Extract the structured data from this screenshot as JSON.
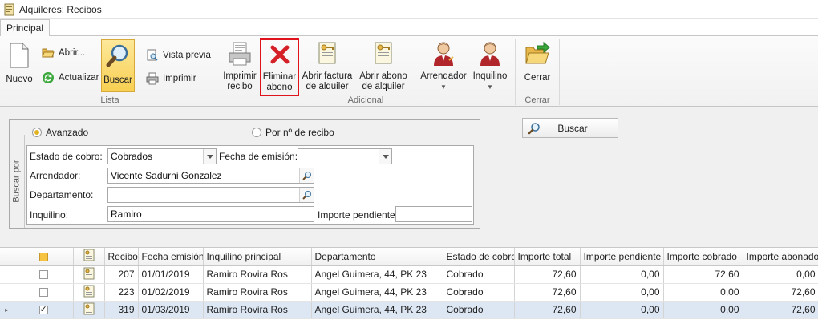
{
  "window": {
    "title": "Alquileres: Recibos"
  },
  "tabs": [
    {
      "label": "Principal"
    }
  ],
  "ribbon": {
    "lista": {
      "label": "Lista",
      "nuevo": "Nuevo",
      "abrir": "Abrir...",
      "actualizar": "Actualizar",
      "buscar": "Buscar",
      "vista_previa": "Vista previa",
      "imprimir": "Imprimir"
    },
    "adicional": {
      "label": "Adicional",
      "imprimir_recibo_1": "Imprimir",
      "imprimir_recibo_2": "recibo",
      "eliminar_abono_1": "Eliminar",
      "eliminar_abono_2": "abono",
      "abrir_factura_1": "Abrir factura",
      "abrir_factura_2": "de alquiler",
      "abrir_abono_1": "Abrir abono",
      "abrir_abono_2": "de alquiler",
      "arrendador": "Arrendador",
      "inquilino": "Inquilino"
    },
    "cerrar": {
      "label": "Cerrar",
      "button": "Cerrar"
    }
  },
  "search": {
    "group_label": "Buscar por",
    "mode_avanzado": "Avanzado",
    "mode_recibo": "Por nº de recibo",
    "estado_label": "Estado de cobro:",
    "estado_value": "Cobrados",
    "fecha_label": "Fecha de emisión:",
    "fecha_value": "",
    "arrendador_label": "Arrendador:",
    "arrendador_value": "Vicente Sadurni Gonzalez",
    "departamento_label": "Departamento:",
    "departamento_value": "",
    "inquilino_label": "Inquilino:",
    "inquilino_value": "Ramiro",
    "importe_label": "Importe pendiente:",
    "importe_value": "",
    "buscar_button": "Buscar"
  },
  "grid": {
    "columns": [
      "Recibo",
      "Fecha emisión",
      "Inquilino principal",
      "Departamento",
      "Estado de cobro",
      "Importe total",
      "Importe pendiente",
      "Importe cobrado",
      "Importe abonado"
    ],
    "rows": [
      {
        "checked": false,
        "recibo": "207",
        "fecha": "01/01/2019",
        "inquilino": "Ramiro Rovira Ros",
        "departamento": "Angel Guimera, 44, PK 23",
        "estado": "Cobrado",
        "total": "72,60",
        "pendiente": "0,00",
        "cobrado": "72,60",
        "abonado": "0,00"
      },
      {
        "checked": false,
        "recibo": "223",
        "fecha": "01/02/2019",
        "inquilino": "Ramiro Rovira Ros",
        "departamento": "Angel Guimera, 44, PK 23",
        "estado": "Cobrado",
        "total": "72,60",
        "pendiente": "0,00",
        "cobrado": "0,00",
        "abonado": "72,60"
      },
      {
        "checked": true,
        "recibo": "319",
        "fecha": "01/03/2019",
        "inquilino": "Ramiro Rovira Ros",
        "departamento": "Angel Guimera, 44, PK 23",
        "estado": "Cobrado",
        "total": "72,60",
        "pendiente": "0,00",
        "cobrado": "0,00",
        "abonado": "72,60"
      }
    ]
  }
}
